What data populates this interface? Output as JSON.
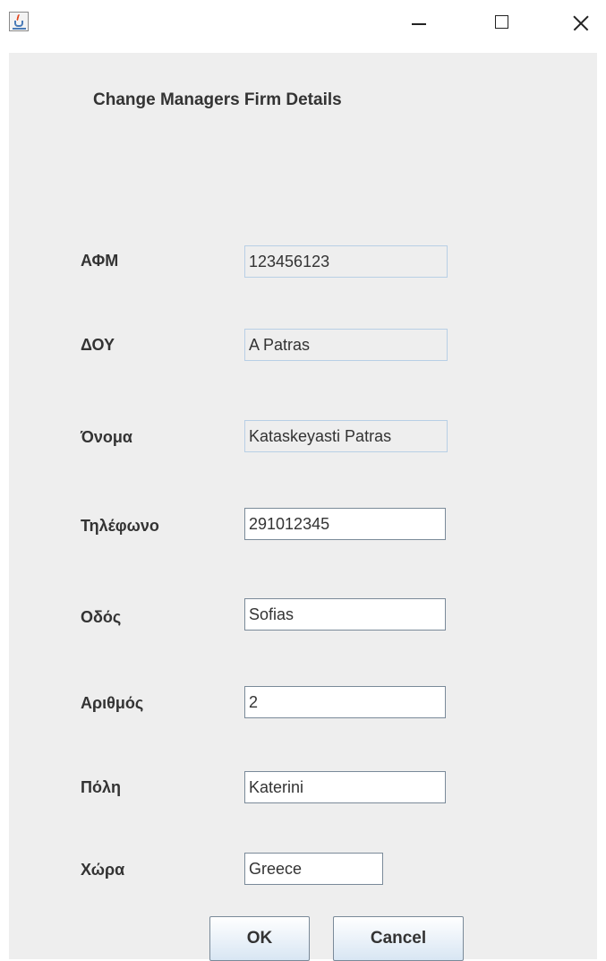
{
  "window": {
    "controls": {
      "minimize_icon": "minimize-icon",
      "maximize_icon": "maximize-icon",
      "close_icon": "close-icon"
    },
    "app_icon": "java-cup-icon"
  },
  "dialog": {
    "title": "Change Managers Firm Details",
    "fields": {
      "afm": {
        "label": "ΑΦΜ",
        "value": "123456123",
        "editable": false
      },
      "doy": {
        "label": "ΔΟΥ",
        "value": "A Patras",
        "editable": false
      },
      "onoma": {
        "label": "Όνομα",
        "value": "Kataskeyasti Patras",
        "editable": false
      },
      "tilefono": {
        "label": "Τηλέφωνο",
        "value": "291012345",
        "editable": true
      },
      "odos": {
        "label": "Οδός",
        "value": "Sofias",
        "editable": true
      },
      "arithmos": {
        "label": "Αριθμός",
        "value": "2",
        "editable": true
      },
      "poli": {
        "label": "Πόλη",
        "value": "Katerini",
        "editable": true
      },
      "xora": {
        "label": "Χώρα",
        "value": "Greece",
        "editable": true
      }
    },
    "buttons": {
      "ok": "OK",
      "cancel": "Cancel"
    }
  },
  "colors": {
    "panel_bg": "#eeeeee",
    "readonly_border": "#b8cfe5",
    "editable_border": "#7a8a99",
    "button_gradient_bottom": "#d8e6f3"
  }
}
